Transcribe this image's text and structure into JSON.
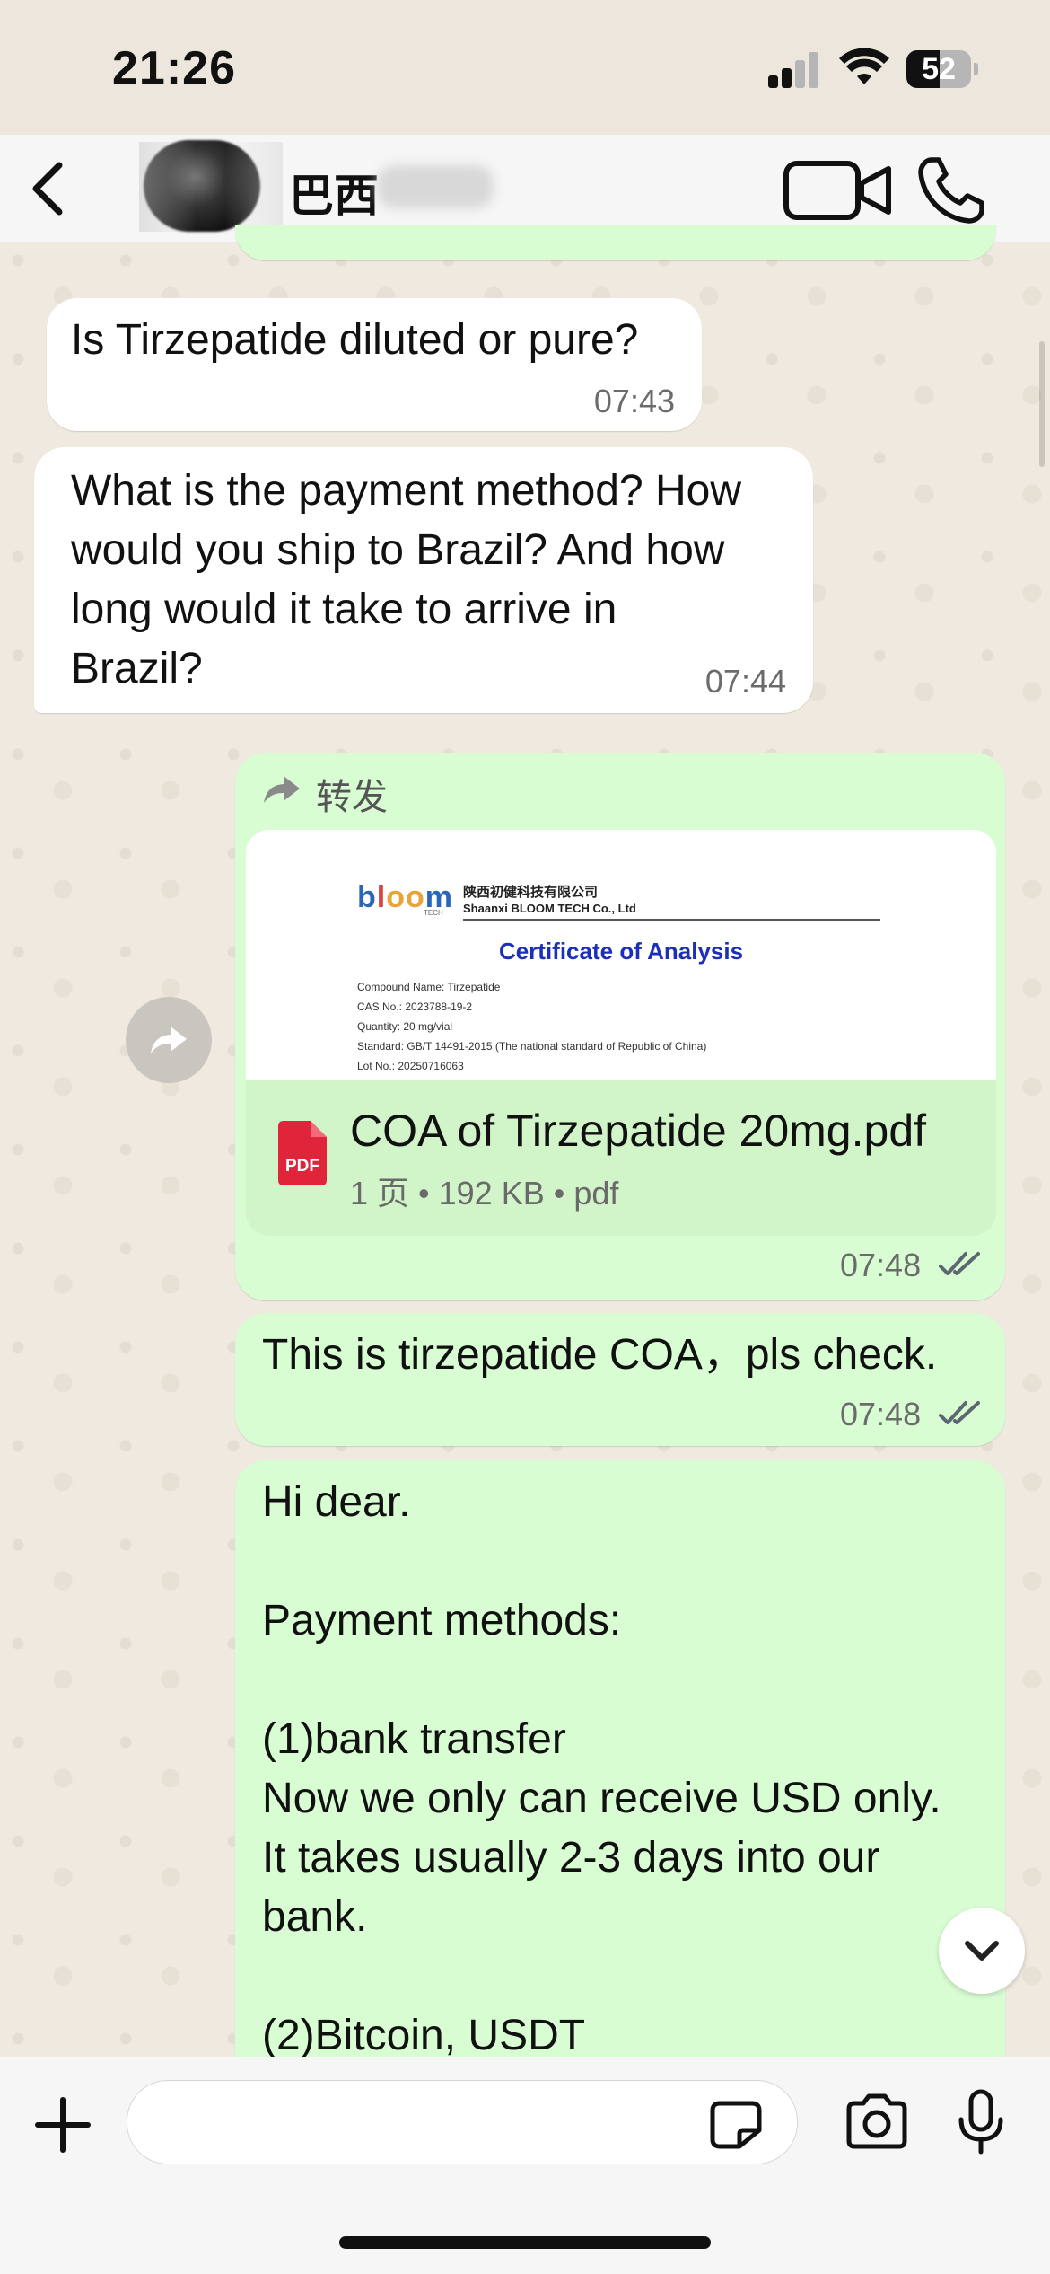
{
  "status_bar": {
    "time": "21:26",
    "battery": "52",
    "battery_level": 0.52
  },
  "header": {
    "contact_name": "巴西",
    "back_icon": "chevron-left-icon",
    "video_icon": "video-camera-icon",
    "call_icon": "phone-icon"
  },
  "messages": [
    {
      "direction": "in",
      "text": "Is Tirzepatide diluted or pure?",
      "time": "07:43"
    },
    {
      "direction": "in",
      "text": "What is the payment method? How\nwould you ship to Brazil? And how\nlong would it take to arrive in\nBrazil?",
      "time": "07:44"
    },
    {
      "direction": "out",
      "forwarded_label": "转发",
      "document": {
        "preview": {
          "logo": "bloom",
          "logo_tag": "TECH",
          "company_cn": "陕西初健科技有限公司",
          "company_en": "Shaanxi BLOOM TECH Co., Ltd",
          "title": "Certificate of Analysis",
          "lines": [
            "Compound Name: Tirzepatide",
            "CAS No.: 2023788-19-2",
            "Quantity: 20 mg/vial",
            "Standard: GB/T 14491-2015 (The national standard of Republic of China)",
            "Lot No.: 20250716063"
          ]
        },
        "file_name": "COA of Tirzepatide 20mg.pdf",
        "meta": "1 页 • 192 KB • pdf",
        "icon_label": "PDF"
      },
      "time": "07:48"
    },
    {
      "direction": "out",
      "text": "This is tirzepatide COA，pls check.",
      "time": "07:48"
    },
    {
      "direction": "out",
      "text": "Hi dear.\n\nPayment methods:\n\n(1)bank transfer\nNow we only can receive USD only.\nIt takes usually 2-3 days into our\nbank.\n\n(2)Bitcoin, USDT"
    }
  ],
  "input_bar": {
    "placeholder": "",
    "icons": [
      "plus-icon",
      "sticker-icon",
      "camera-icon",
      "microphone-icon"
    ]
  },
  "colors": {
    "incoming": "#ffffff",
    "outgoing": "#d9fdd3",
    "background": "#efe9df",
    "pdf_red": "#e0243a",
    "read_tick": "#53bdeb"
  }
}
